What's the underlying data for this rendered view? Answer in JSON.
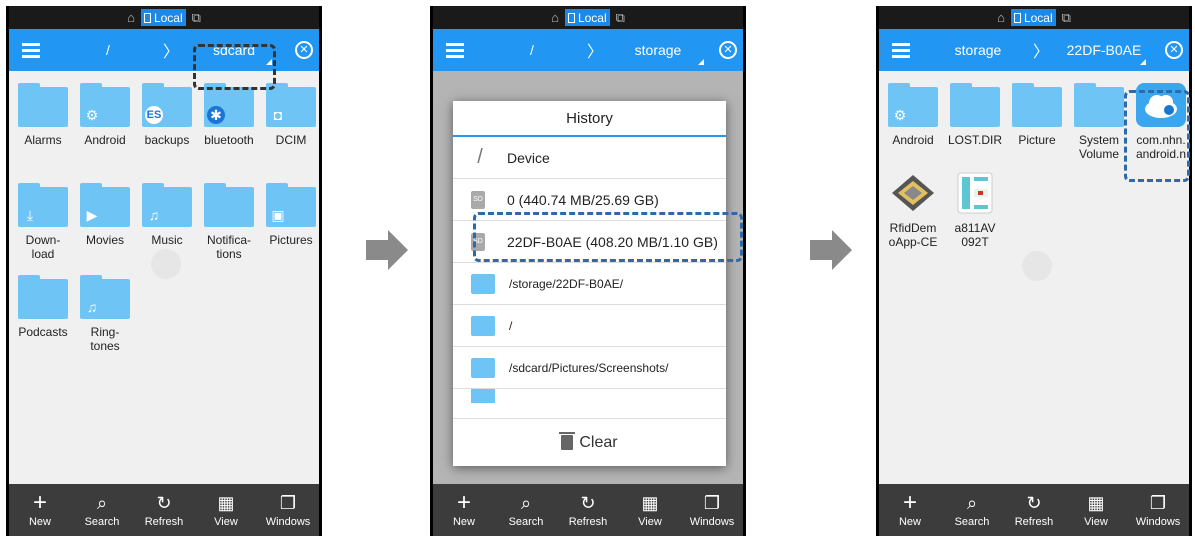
{
  "status": {
    "local_label": "Local"
  },
  "screen1": {
    "path": [
      "/",
      "sdcard"
    ],
    "folders": [
      {
        "label": "Alarms",
        "badge": ""
      },
      {
        "label": "Android",
        "badge": "⚙"
      },
      {
        "label": "backups",
        "badge": "ES"
      },
      {
        "label": "bluetooth",
        "badge": "✱"
      },
      {
        "label": "DCIM",
        "badge": "◘"
      },
      {
        "label": "Down-\nload",
        "badge": "⤓"
      },
      {
        "label": "Movies",
        "badge": "▶"
      },
      {
        "label": "Music",
        "badge": "♫"
      },
      {
        "label": "Notifica-\ntions",
        "badge": ""
      },
      {
        "label": "Pictures",
        "badge": "▣"
      },
      {
        "label": "Podcasts",
        "badge": ""
      },
      {
        "label": "Ring-\ntones",
        "badge": "♫"
      }
    ]
  },
  "screen2": {
    "path": [
      "/",
      "storage"
    ],
    "history_title": "History",
    "history_items": [
      {
        "type": "slash",
        "label": "Device"
      },
      {
        "type": "sd",
        "label": "0 (440.74 MB/25.69 GB)"
      },
      {
        "type": "sd",
        "label": "22DF-B0AE (408.20 MB/1.10 GB)"
      },
      {
        "type": "folder",
        "label": "/storage/22DF-B0AE/"
      },
      {
        "type": "folder",
        "label": "/"
      },
      {
        "type": "folder",
        "label": "/sdcard/Pictures/Screenshots/"
      }
    ],
    "clear_label": "Clear"
  },
  "screen3": {
    "path": [
      "storage",
      "22DF-B0AE"
    ],
    "items": [
      {
        "label": "Android",
        "kind": "folder"
      },
      {
        "label": "LOST.DIR",
        "kind": "folder"
      },
      {
        "label": "Picture",
        "kind": "folder"
      },
      {
        "label": "System\nVolume",
        "kind": "folder"
      },
      {
        "label": "com.nhn.\nandroid.n",
        "kind": "app"
      },
      {
        "label": "RfidDem\noApp-CE",
        "kind": "app"
      },
      {
        "label": "a811AV\n092T",
        "kind": "app"
      }
    ]
  },
  "toolbar": [
    "New",
    "Search",
    "Refresh",
    "View",
    "Windows"
  ],
  "toolbar_icons": [
    "plus-icon",
    "search-icon",
    "refresh-icon",
    "grid-icon",
    "windows-icon"
  ],
  "colors": {
    "accent": "#2196f3",
    "folder": "#6ec4f5",
    "highlight": "#2d6aa8"
  }
}
